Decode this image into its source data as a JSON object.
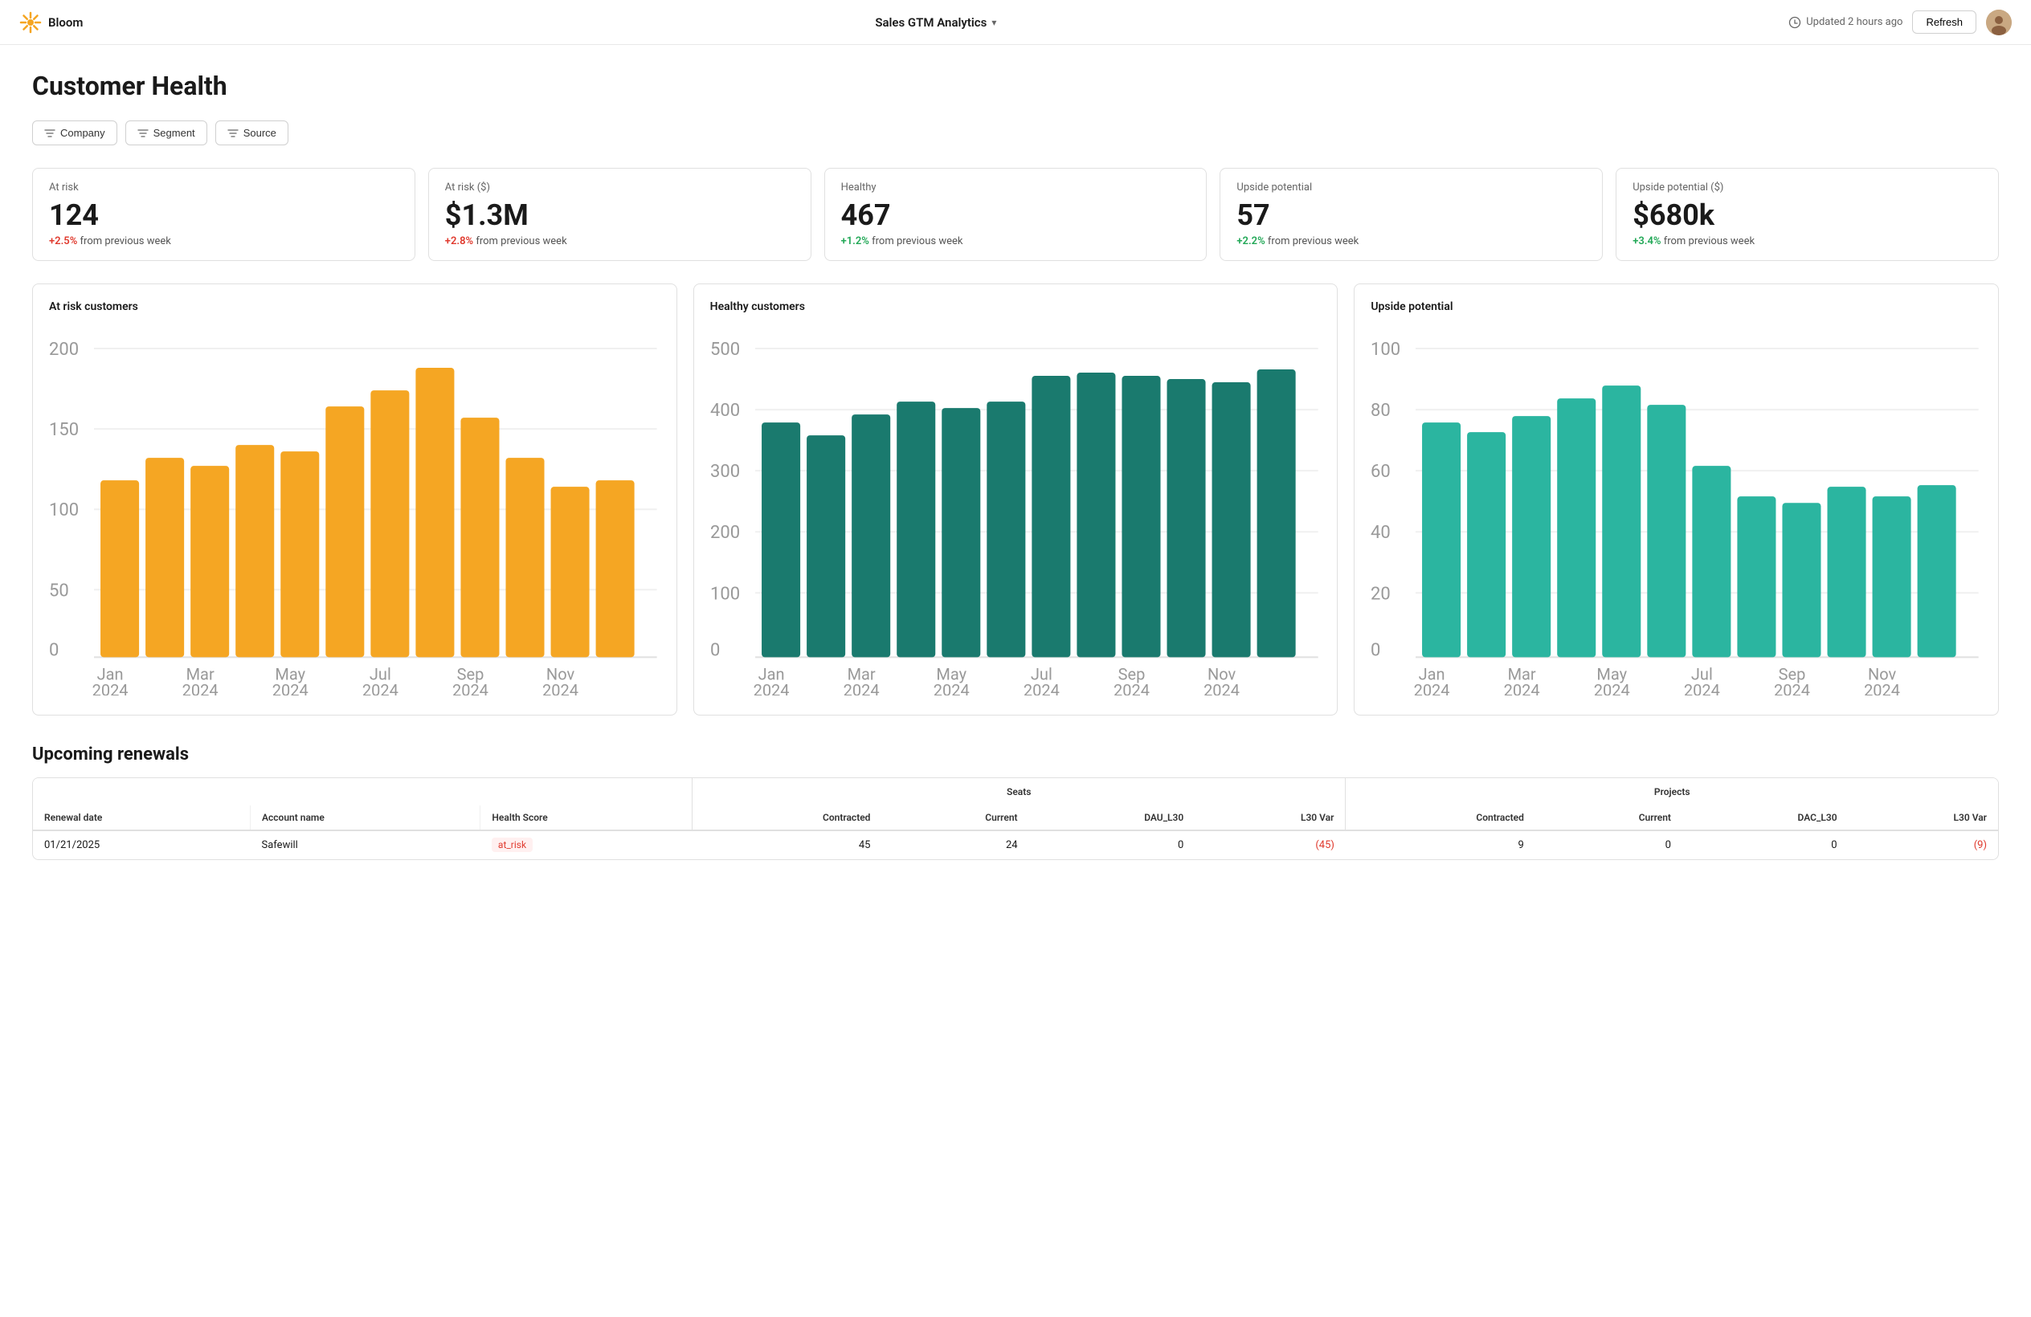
{
  "header": {
    "logo_alt": "Bloom logo",
    "app_name": "Bloom",
    "dashboard_title": "Sales GTM Analytics",
    "updated_text": "Updated 2 hours ago",
    "refresh_label": "Refresh"
  },
  "page": {
    "title": "Customer Health"
  },
  "filters": [
    {
      "id": "company",
      "label": "Company"
    },
    {
      "id": "segment",
      "label": "Segment"
    },
    {
      "id": "source",
      "label": "Source"
    }
  ],
  "kpis": [
    {
      "id": "at-risk",
      "label": "At risk",
      "value": "124",
      "change_prefix": "+2.5%",
      "change_suffix": "from previous week",
      "positive": false
    },
    {
      "id": "at-risk-dollars",
      "label": "At risk ($)",
      "value": "$1.3M",
      "change_prefix": "+2.8%",
      "change_suffix": "from previous week",
      "positive": false
    },
    {
      "id": "healthy",
      "label": "Healthy",
      "value": "467",
      "change_prefix": "+1.2%",
      "change_suffix": "from previous week",
      "positive": true
    },
    {
      "id": "upside-potential",
      "label": "Upside potential",
      "value": "57",
      "change_prefix": "+2.2%",
      "change_suffix": "from previous week",
      "positive": true
    },
    {
      "id": "upside-potential-dollars",
      "label": "Upside potential ($)",
      "value": "$680k",
      "change_prefix": "+3.4%",
      "change_suffix": "from previous week",
      "positive": true
    }
  ],
  "charts": [
    {
      "id": "at-risk-chart",
      "title": "At risk customers",
      "color": "#F5A623",
      "y_max": 200,
      "y_labels": [
        "200",
        "150",
        "100",
        "50",
        "0"
      ],
      "bars": [
        115,
        130,
        125,
        138,
        133,
        163,
        172,
        182,
        157,
        130,
        110,
        115
      ],
      "x_labels": [
        "Jan\n2024",
        "Mar\n2024",
        "May\n2024",
        "Jul\n2024",
        "Sep\n2024",
        "Nov\n2024"
      ],
      "x_labels_full": [
        "Jan\n2024",
        "",
        "Mar\n2024",
        "",
        "May\n2024",
        "",
        "Jul\n2024",
        "",
        "Sep\n2024",
        "",
        "Nov\n2024",
        ""
      ]
    },
    {
      "id": "healthy-chart",
      "title": "Healthy customers",
      "color": "#1A7A6E",
      "y_max": 500,
      "y_labels": [
        "500",
        "400",
        "300",
        "200",
        "100",
        "0"
      ],
      "bars": [
        380,
        360,
        395,
        415,
        405,
        415,
        455,
        460,
        455,
        450,
        445,
        465
      ],
      "x_labels_full": [
        "Jan\n2024",
        "",
        "Mar\n2024",
        "",
        "May\n2024",
        "",
        "Jul\n2024",
        "",
        "Sep\n2024",
        "",
        "Nov\n2024",
        ""
      ]
    },
    {
      "id": "upside-chart",
      "title": "Upside potential",
      "color": "#2BB5A0",
      "y_max": 100,
      "y_labels": [
        "100",
        "80",
        "60",
        "40",
        "20",
        "0"
      ],
      "bars": [
        76,
        73,
        78,
        84,
        88,
        82,
        62,
        52,
        50,
        55,
        52,
        56
      ],
      "x_labels_full": [
        "Jan\n2024",
        "",
        "Mar\n2024",
        "",
        "May\n2024",
        "",
        "Jul\n2024",
        "",
        "Sep\n2024",
        "",
        "Nov\n2024",
        ""
      ]
    }
  ],
  "renewals": {
    "section_title": "Upcoming renewals",
    "col_groups": [
      {
        "label": "",
        "span": 3
      },
      {
        "label": "Seats",
        "span": 4
      },
      {
        "label": "Projects",
        "span": 4
      }
    ],
    "columns": [
      "Renewal date",
      "Account name",
      "Health Score",
      "Seats\nContracted",
      "Seats\nCurrent",
      "Seats\nDAU_L30",
      "Seats\nL30 Var",
      "Projects\nContracted",
      "Projects\nCurrent",
      "Projects\nDAC_L30",
      "Projects\nL30 Var"
    ],
    "rows": [
      {
        "renewal_date": "01/21/2025",
        "account_name": "Safewill",
        "health_score": "at_risk",
        "seats_contracted": 45,
        "seats_current": 24,
        "seats_dau_l30": 0,
        "seats_l30_var": -45,
        "projects_contracted": 9,
        "projects_current": 0,
        "projects_dac_l30": 0,
        "projects_l30_var": -9
      }
    ]
  },
  "colors": {
    "accent_orange": "#F5A623",
    "accent_teal_dark": "#1A7A6E",
    "accent_teal_light": "#2BB5A0",
    "positive": "#22a857",
    "negative": "#e03a2e"
  }
}
